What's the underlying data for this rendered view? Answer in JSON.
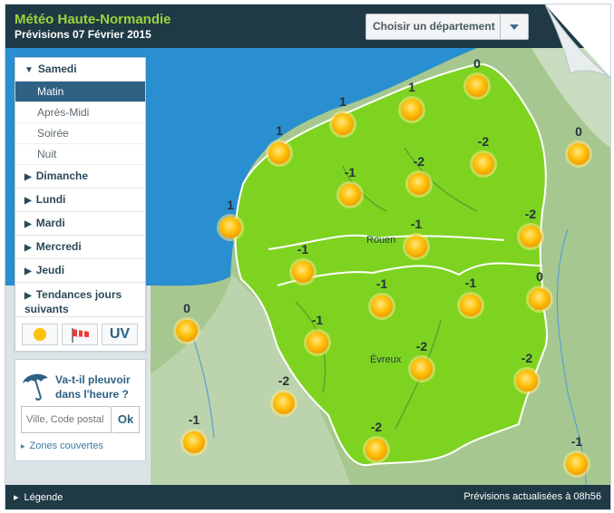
{
  "header": {
    "title": "Météo Haute-Normandie",
    "subtitle": "Prévisions 07 Février 2015",
    "dept_placeholder": "Choisir un département"
  },
  "sidebar": {
    "days": [
      {
        "label": "Samedi",
        "expanded": true
      },
      {
        "label": "Dimanche"
      },
      {
        "label": "Lundi"
      },
      {
        "label": "Mardi"
      },
      {
        "label": "Mercredi"
      },
      {
        "label": "Jeudi"
      },
      {
        "label": "Tendances jours suivants"
      }
    ],
    "periods": [
      {
        "label": "Matin",
        "selected": true
      },
      {
        "label": "Après-Midi"
      },
      {
        "label": "Soirée"
      },
      {
        "label": "Nuit"
      }
    ],
    "tools": {
      "sun_icon": "sun-icon",
      "wind_icon": "windsock-icon",
      "uv_label": "UV"
    }
  },
  "rain": {
    "title": "Va-t-il pleuvoir dans l'heure ?",
    "placeholder": "Ville, Code postal",
    "ok_label": "Ok",
    "zones_link": "Zones couvertes"
  },
  "map": {
    "cities": [
      {
        "name": "Rouen"
      },
      {
        "name": "Évreux"
      }
    ],
    "forecasts": [
      {
        "temp": "0",
        "icon": "sun-icon"
      },
      {
        "temp": "1",
        "icon": "sun-icon"
      },
      {
        "temp": "1",
        "icon": "sun-icon"
      },
      {
        "temp": "1",
        "icon": "sun-icon"
      },
      {
        "temp": "0",
        "icon": "sun-icon"
      },
      {
        "temp": "-1",
        "icon": "sun-icon"
      },
      {
        "temp": "-2",
        "icon": "sun-icon"
      },
      {
        "temp": "-2",
        "icon": "sun-icon"
      },
      {
        "temp": "1",
        "icon": "sun-icon"
      },
      {
        "temp": "-1",
        "icon": "sun-icon"
      },
      {
        "temp": "-2",
        "icon": "sun-icon"
      },
      {
        "temp": "-1",
        "icon": "sun-icon"
      },
      {
        "temp": "-1",
        "icon": "sun-icon"
      },
      {
        "temp": "-1",
        "icon": "sun-icon"
      },
      {
        "temp": "0",
        "icon": "sun-icon"
      },
      {
        "temp": "0",
        "icon": "sun-icon"
      },
      {
        "temp": "-1",
        "icon": "sun-icon"
      },
      {
        "temp": "-2",
        "icon": "sun-icon"
      },
      {
        "temp": "-2",
        "icon": "sun-icon"
      },
      {
        "temp": "-2",
        "icon": "sun-icon"
      },
      {
        "temp": "-2",
        "icon": "sun-icon"
      },
      {
        "temp": "-1",
        "icon": "sun-icon"
      },
      {
        "temp": "-1",
        "icon": "sun-icon"
      }
    ]
  },
  "footer": {
    "legend_label": "Légende",
    "updated": "Prévisions actualisées à 08h56"
  },
  "colors": {
    "header_bg": "#1f3a45",
    "title_green": "#9fd33b",
    "region_green": "#7ed321",
    "sea_blue": "#2a8fd0",
    "selected_blue": "#2e6184",
    "sun_yellow": "#ffc20e"
  }
}
